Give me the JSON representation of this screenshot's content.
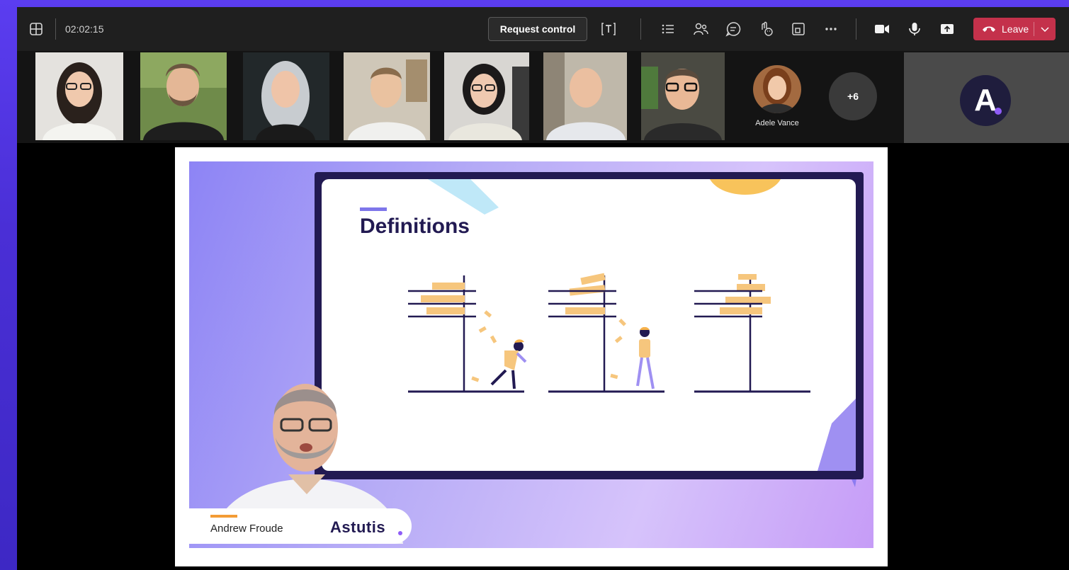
{
  "toolbar": {
    "timer": "02:02:15",
    "request_control_label": "Request control",
    "leave_label": "Leave",
    "icons": [
      "layout-icon",
      "text-format-icon",
      "list-icon",
      "people-icon",
      "chat-icon",
      "reactions-icon",
      "rooms-icon",
      "more-icon",
      "camera-icon",
      "mic-icon",
      "share-icon",
      "phone-icon",
      "chevron-down-icon"
    ]
  },
  "participants": {
    "featured_name": "Adele Vance",
    "overflow_label": "+6",
    "brand_letter": "A"
  },
  "slide": {
    "title": "Definitions",
    "presenter_name": "Andrew Froude",
    "company": "Astutis"
  },
  "colors": {
    "toolbar_bg": "#1f1f1f",
    "leave_red": "#c4314b",
    "slide_navy": "#221a52",
    "brick_orange": "#f6c67d",
    "accent_purple": "#8f5cf7"
  }
}
